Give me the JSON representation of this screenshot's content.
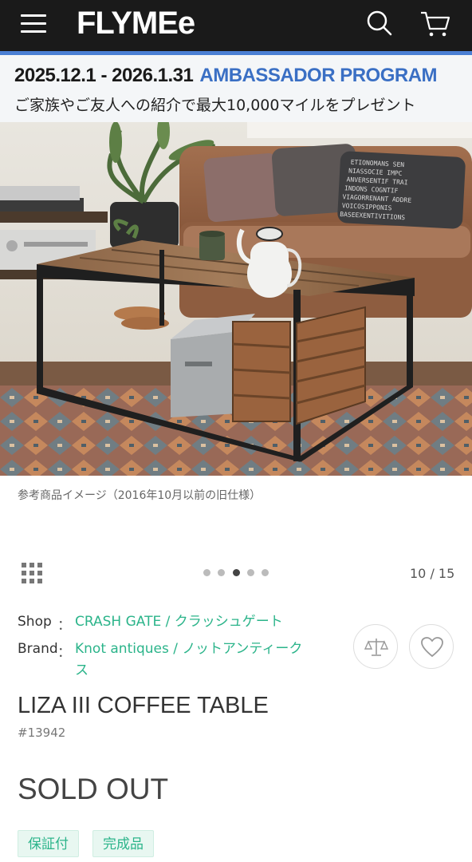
{
  "header": {
    "logo": "FLYMEe",
    "icons": {
      "menu": "hamburger-menu-icon",
      "search": "search-icon",
      "cart": "cart-icon"
    },
    "background": "#1a1a1a",
    "accent_line": "#4a7fd4"
  },
  "banner": {
    "dates": "2025.12.1 - 2026.1.31",
    "program": "AMBASSADOR PROGRAM",
    "description": "ご家族やご友人への紹介で最大10,000マイルをプレゼント",
    "program_color": "#3a6fc4"
  },
  "product_image": {
    "caption": "参考商品イメージ（2016年10月以前の旧仕様）",
    "pillow_text": [
      "ETIONOMANS SEN",
      "NIASSOCIE IMPC",
      "ANVERSENTIF TRAI",
      "INDONS COGNTIF",
      "VIAGORRENANT ADDRE",
      "VOICOSIPPONIS",
      "BASEEXENTIVITIONS"
    ]
  },
  "gallery": {
    "grid_icon": "grid-view-icon",
    "total_dots": 5,
    "active_dot": 2,
    "counter": "10 / 15"
  },
  "shop": {
    "label": "Shop",
    "colon": "：",
    "name": "CRASH GATE / クラッシュゲート"
  },
  "brand": {
    "label": "Brand",
    "colon": "：",
    "name_line1": "Knot antiques / ノットアンティーク",
    "name_line2": "ス"
  },
  "actions": {
    "compare_icon": "scale-compare-icon",
    "favorite_icon": "heart-icon"
  },
  "product": {
    "name": "LIZA III COFFEE TABLE",
    "id": "#13942",
    "status": "SOLD OUT",
    "tags": [
      "保証付",
      "完成品"
    ]
  },
  "colors": {
    "link": "#2bb48a",
    "tag_bg": "#e8f7f1"
  }
}
